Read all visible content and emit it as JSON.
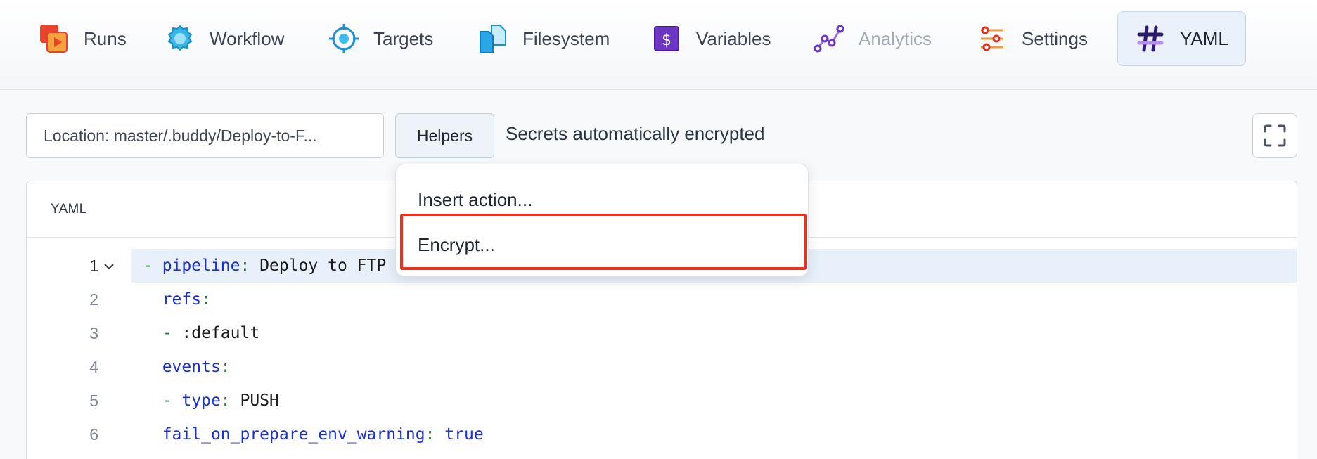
{
  "tabs": [
    {
      "label": "Runs",
      "icon": "runs-icon"
    },
    {
      "label": "Workflow",
      "icon": "workflow-gear-icon"
    },
    {
      "label": "Targets",
      "icon": "target-icon"
    },
    {
      "label": "Filesystem",
      "icon": "files-icon"
    },
    {
      "label": "Variables",
      "icon": "variables-dollar-icon"
    },
    {
      "label": "Analytics",
      "icon": "analytics-icon",
      "state": "disabled"
    },
    {
      "label": "Settings",
      "icon": "settings-sliders-icon"
    },
    {
      "label": "YAML",
      "icon": "yaml-hash-icon",
      "state": "active"
    }
  ],
  "toolbar": {
    "location_value": "Location: master/.buddy/Deploy-to-F...",
    "helpers_label": "Helpers",
    "secrets_text": "Secrets automatically encrypted",
    "fullscreen_icon": "fullscreen-icon"
  },
  "editor": {
    "header": "YAML",
    "lines": [
      {
        "num": "1",
        "text": "- pipeline: Deploy to FTP"
      },
      {
        "num": "2",
        "text": "  refs:"
      },
      {
        "num": "3",
        "text": "  - :default"
      },
      {
        "num": "4",
        "text": "  events:"
      },
      {
        "num": "5",
        "text": "  - type: PUSH"
      },
      {
        "num": "6",
        "text": "  fail_on_prepare_env_warning: true"
      }
    ]
  },
  "menu": {
    "items": [
      "Insert action...",
      "Encrypt..."
    ]
  },
  "colors": {
    "accent": "#1a2fd6",
    "highlight": "#e8321f",
    "active_tab_bg": "#eaf1fa"
  }
}
